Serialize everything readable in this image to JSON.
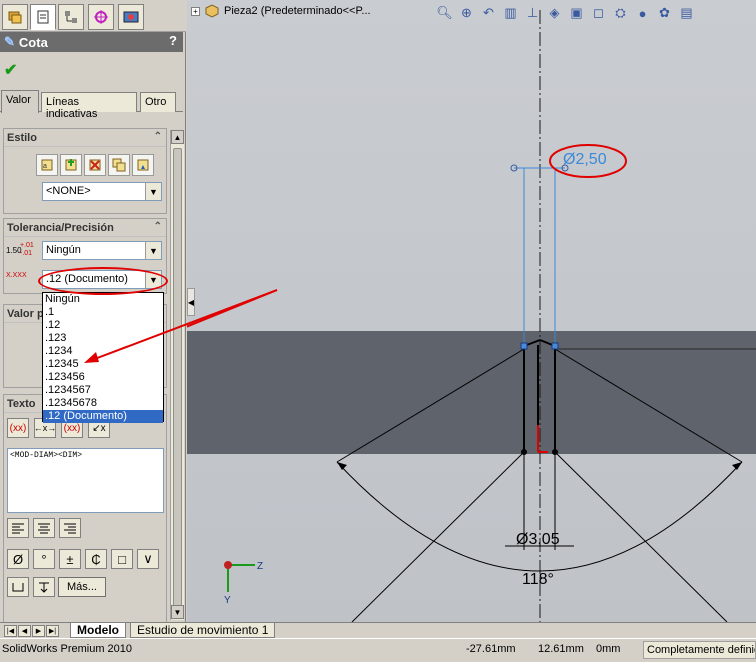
{
  "app": {
    "name": "SolidWorks Premium 2010"
  },
  "property_manager": {
    "title": "Cota",
    "help_label": "?",
    "ok_label": "✔",
    "tabs": [
      {
        "label": "Valor"
      },
      {
        "label": "Líneas indicativas"
      },
      {
        "label": "Otro"
      }
    ],
    "estilo": {
      "title": "Estilo",
      "style_value": "<NONE>",
      "icons": [
        "apply-default-icon",
        "add-style-icon",
        "delete-style-icon",
        "save-style-icon",
        "load-style-icon"
      ]
    },
    "tolerancia": {
      "title": "Tolerancia/Precisión",
      "tolerance_icon_top": "1.50",
      "tolerance_icon_sup": "+.01",
      "tolerance_icon_sub": "-.01",
      "precision_icon": "X.XXX",
      "tolerance_type": "Ningún",
      "precision_value": ".12 (Documento)"
    },
    "precision_options": [
      "Ningún",
      ".1",
      ".12",
      ".123",
      ".1234",
      ".12345",
      ".123456",
      ".1234567",
      ".12345678",
      ".12 (Documento)"
    ],
    "selected_option": ".12 (Documento)",
    "valor_group_title": "Valor p",
    "texto": {
      "title": "Texto",
      "content": "<MOD-DIAM><DIM>",
      "symbols": [
        "Ø",
        "°",
        "±",
        "₵",
        "□",
        "∨"
      ],
      "mas_label": "Más..."
    }
  },
  "graphics": {
    "document_title": "Pieza2  (Predeterminado<<P...",
    "dim_top": "Ø2,50",
    "dim_bottom": "Ø3,05",
    "dim_angle": "118°",
    "triad_z": "Z",
    "triad_y": "Y",
    "colors": {
      "background": "#c5c9ce",
      "part_band": "#5f636b",
      "dimension_blue": "#3a8ad8",
      "annotation_red": "#e00000"
    }
  },
  "bottom_tabs": [
    {
      "label": "Modelo"
    },
    {
      "label": "Estudio de movimiento 1"
    }
  ],
  "status_bar": {
    "x": "-27.61mm",
    "y": "12.61mm",
    "z": "0mm",
    "state": "Completamente definida"
  }
}
